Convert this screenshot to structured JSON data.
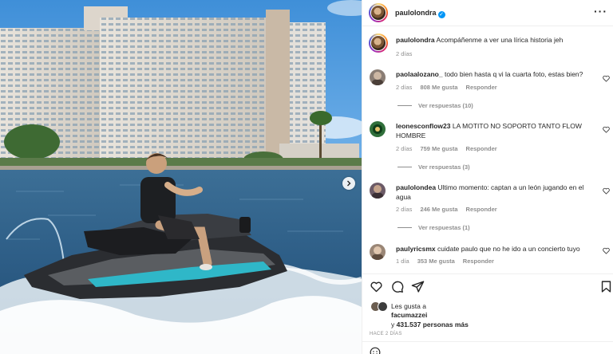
{
  "post": {
    "username": "paulolondra",
    "caption_user": "paulolondra",
    "caption_text": "Acompáñenme a ver una lírica historia jeh",
    "caption_time": "2 días",
    "more_icon": "more-horizontal-icon",
    "next_icon": "chevron-right-icon"
  },
  "comments": [
    {
      "user": "paolaalozano_",
      "text": "todo bien hasta q vi la cuarta foto, estas bien?",
      "time": "2 días",
      "likes": "808 Me gusta",
      "reply": "Responder",
      "view_replies": "Ver respuestas (10)",
      "avatar_color": "#8a7d74"
    },
    {
      "user": "leonesconflow23",
      "text": "LA MOTITO NO SOPORTO TANTO FLOW HOMBRE",
      "time": "2 días",
      "likes": "759 Me gusta",
      "reply": "Responder",
      "view_replies": "Ver respuestas (3)",
      "avatar_color": "#2f6f3a"
    },
    {
      "user": "paulolondea",
      "text": "Ultimo momento: captan a un león jugando en el agua",
      "time": "2 días",
      "likes": "246 Me gusta",
      "reply": "Responder",
      "view_replies": "Ver respuestas (1)",
      "avatar_color": "#6b5a66"
    },
    {
      "user": "paulyricsmx",
      "text": "cuidate paulo que no he ido a un concierto tuyo",
      "time": "1 día",
      "likes": "353 Me gusta",
      "reply": "Responder",
      "avatar_color": "#9a8676"
    }
  ],
  "likes": {
    "prefix": "Les gusta a",
    "user": "facumazzei",
    "and": "y",
    "count": "431.537 personas más"
  },
  "posted_ago": "HACE 2 DÍAS",
  "icons": {
    "like": "heart-icon",
    "comment": "comment-icon",
    "share": "send-icon",
    "save": "bookmark-icon"
  },
  "colors": {
    "verified": "#0095f6",
    "muted": "#8e8e8e",
    "text": "#262626"
  }
}
